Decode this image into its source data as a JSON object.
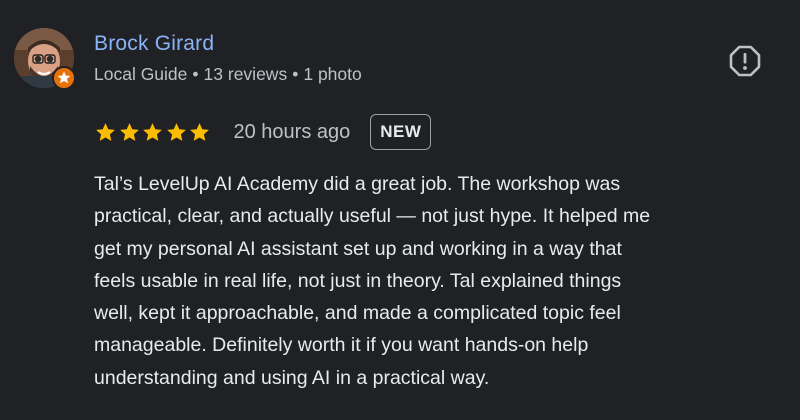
{
  "reviewer": {
    "name": "Brock Girard",
    "guide_label": "Local Guide",
    "reviews": "13 reviews",
    "photos": "1 photo",
    "separator": "•"
  },
  "rating": {
    "stars": 5,
    "max_stars": 5,
    "star_color": "#fbbc04",
    "timestamp": "20 hours ago",
    "badge": "NEW"
  },
  "review": {
    "lines": [
      "Tal’s LevelUp AI Academy did a great job. The workshop was",
      "practical, clear, and actually useful — not just hype. It helped me",
      "get my personal AI assistant set up and working in a way that",
      "feels usable in real life, not just in theory. Tal explained things",
      "well, kept it approachable, and made a complicated topic feel",
      "manageable. Definitely worth it if you want hands-on help",
      "understanding and using AI in a practical way."
    ]
  },
  "icons": {
    "avatar": "reviewer-avatar",
    "guide_badge": "local-guide-star-icon",
    "flag": "report-flag-icon"
  },
  "colors": {
    "background": "#202124",
    "name": "#8ab4f8",
    "text": "#e8eaed",
    "muted": "#bdc1c6",
    "guide_badge": "#e8710a"
  }
}
